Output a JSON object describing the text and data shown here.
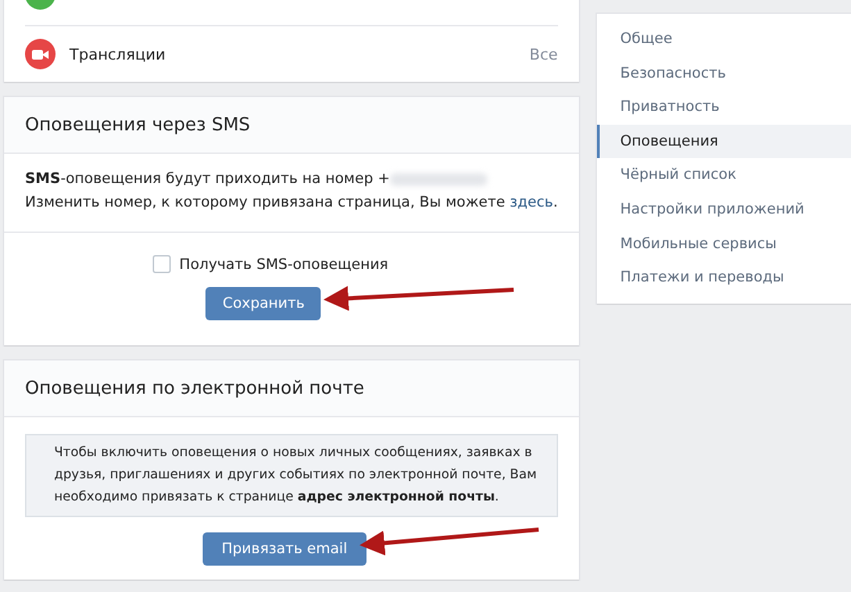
{
  "top_card": {
    "rows": [
      {
        "kind": "status"
      },
      {
        "kind": "broadcast",
        "label": "Трансляции",
        "link": "Все"
      }
    ]
  },
  "sms_section": {
    "title": "Оповещения через SMS",
    "info": "**SMS**-оповещения будут приходить на номер +",
    "number_hidden": true,
    "change_text": "Изменить номер, к которому привязана страница, Вы можете ",
    "change_link": "здесь",
    "change_end": ".",
    "checkbox": {
      "label": "Получать SMS-оповещения",
      "checked": false
    },
    "button": "Сохранить"
  },
  "email_section": {
    "title": "Оповещения по электронной почте",
    "info": "Чтобы включить оповещения о новых личных сообщениях, заявках в друзья, приглашениях и других событиях по электронной почте, Вам необходимо привязать к странице **адрес электронной почты**.",
    "button": "Привязать email"
  },
  "sidebar": {
    "items": [
      {
        "label": "Общее",
        "selected": false
      },
      {
        "label": "Безопасность",
        "selected": false
      },
      {
        "label": "Приватность",
        "selected": false
      },
      {
        "label": "Оповещения",
        "selected": true
      },
      {
        "label": "Чёрный список",
        "selected": false
      },
      {
        "label": "Настройки приложений",
        "selected": false
      },
      {
        "label": "Мобильные сервисы",
        "selected": false
      },
      {
        "label": "Платежи и переводы",
        "selected": false
      }
    ]
  }
}
